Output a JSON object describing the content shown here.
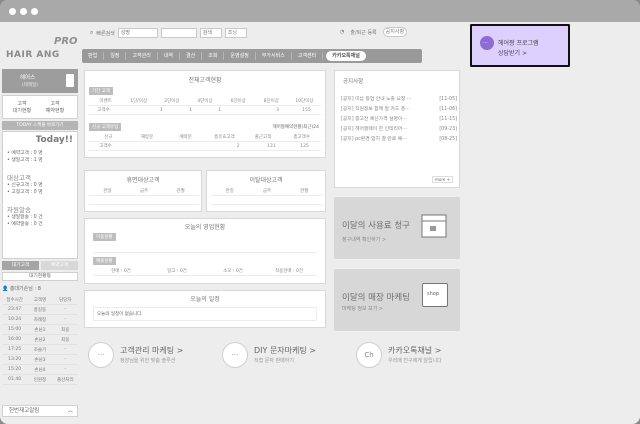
{
  "brand": {
    "pro": "PRO",
    "name": "HAIR  ANG"
  },
  "search": {
    "label": "빠른검색",
    "select": "성명",
    "button": "검색",
    "button2": "조닝"
  },
  "topbar": {
    "menu1": "출/퇴근 등록",
    "menu2": "공지사항"
  },
  "nav": [
    "판업",
    "일정",
    "고객관리",
    "내역",
    "결산",
    "조회",
    "운영설정",
    "부가서비스",
    "고객센터"
  ],
  "nav_kakao": "카카오톡채널",
  "callout": {
    "line1": "헤어짱 프로그램",
    "line2": "상담받기 >"
  },
  "sidebar": {
    "user": "헤어스",
    "user_sub": "(테헤일)",
    "btn_customer": "고객",
    "btn_customer2": "대기현황",
    "btn_reserve": "고객",
    "btn_reserve2": "예약현황",
    "banner": "TODAY 스케줄 바로가기",
    "today": "Today!!",
    "today_items": [
      "• 예약고객 : 0 명",
      "• 생일고객 : 1 명"
    ],
    "section1": "대상고객",
    "section1_items": [
      "• 신규고객 : 0 명",
      "• 고정고객 : 0 명"
    ],
    "section2": "자원알송",
    "section2_items": [
      "• 생일알송 : 0 건",
      "• 예약알송 : 0 건"
    ],
    "tab_waiting": "대기고객",
    "tab_reserve": "예약고객",
    "waitlist_btn": "대기현황등",
    "staff": "총대기손님 : 8",
    "list_header": [
      "접수시간",
      "고객명",
      "담당자"
    ],
    "list_rows": [
      [
        "23:47",
        "홍길동",
        "-"
      ],
      [
        "10:24",
        "차례정",
        "-"
      ],
      [
        "15:00",
        "손님1",
        "최웅"
      ],
      [
        "16:00",
        "손님2",
        "최웅"
      ],
      [
        "17:25",
        "조슬기",
        "-"
      ],
      [
        "13:20",
        "손님3",
        "-"
      ],
      [
        "15:20",
        "손님4",
        "-"
      ],
      [
        "01:40",
        "인원정",
        "출산처리"
      ]
    ],
    "footer": "헌번재고알림"
  },
  "customer_status": {
    "title": "전체고객현황",
    "tag1": "기간 고객",
    "cols": [
      "이벤트",
      "1단/이상",
      "2단이상",
      "4단이상",
      "6단이상",
      "8단이상",
      "10단이상"
    ],
    "row_label": "고객수",
    "row_vals": [
      "",
      "1",
      "1",
      "1",
      "",
      "3",
      "155"
    ],
    "tag2": "신규 고객유입",
    "note": "헤어짱예약현황(최근)24",
    "cols2": [
      "신규",
      "재방문",
      "예약문",
      "총유효고객",
      "출근고객",
      "총고객수"
    ],
    "row2_label": "고객수",
    "row2_vals": [
      "",
      "",
      "",
      "2",
      "131",
      "135"
    ]
  },
  "target": {
    "title": "휴면대상고객",
    "cols": [
      "관일",
      "금주",
      "관월"
    ]
  },
  "leave": {
    "title": "이탈대상고객",
    "cols": [
      "관일",
      "금주",
      "관월"
    ]
  },
  "sales": {
    "title": "오늘의 영업현황",
    "tag1": "이용현황",
    "tag2": "매출현황",
    "items": [
      "현매 : 0건",
      "일고 : 0건",
      "소모 : 0건",
      "적용현매 : 0건"
    ]
  },
  "schedule": {
    "title": "오늘의 일정",
    "empty": "오늘의 일정이 없습니다."
  },
  "notices": {
    "title": "공지사항",
    "items": [
      [
        "[공지] 미납 등업 안내 노출 요청 ···",
        "[11-05]"
      ],
      [
        "[공지] 직원정보 함께 알 카드 총···",
        "[11-06]"
      ],
      [
        "[공지] 증고전 예산가격 설명이···",
        "[11-15]"
      ],
      [
        "[공지] 헤어짱웨이 한 인테리어···",
        "[09-23]"
      ],
      [
        "[공지] pc환경 업치 결 만료 예···",
        "[08-25]"
      ]
    ],
    "more": "more +"
  },
  "promo1": {
    "title": "이달의 사용료 청구",
    "sub": "청구내역 확인하기 >"
  },
  "promo2": {
    "title": "이달의 매장 마케팅",
    "sub": "마케팅 정보 보기 >",
    "shop": "shop"
  },
  "bottom": [
    {
      "icon": "messages-icon",
      "title": "고객관리 마케팅 >",
      "sub": "정장님을 위한 맞춤 솔루션"
    },
    {
      "icon": "chat-icon",
      "title": "DIY 문자마케팅 >",
      "sub": "직접 문자 판매하기"
    },
    {
      "icon": "kakao-ch-icon",
      "title": "카카오톡채널 >",
      "sub": "우리매 친구에게 알립니다"
    }
  ],
  "colors": {
    "accent": "#ddd0ff",
    "nav": "#9a9a9a"
  }
}
